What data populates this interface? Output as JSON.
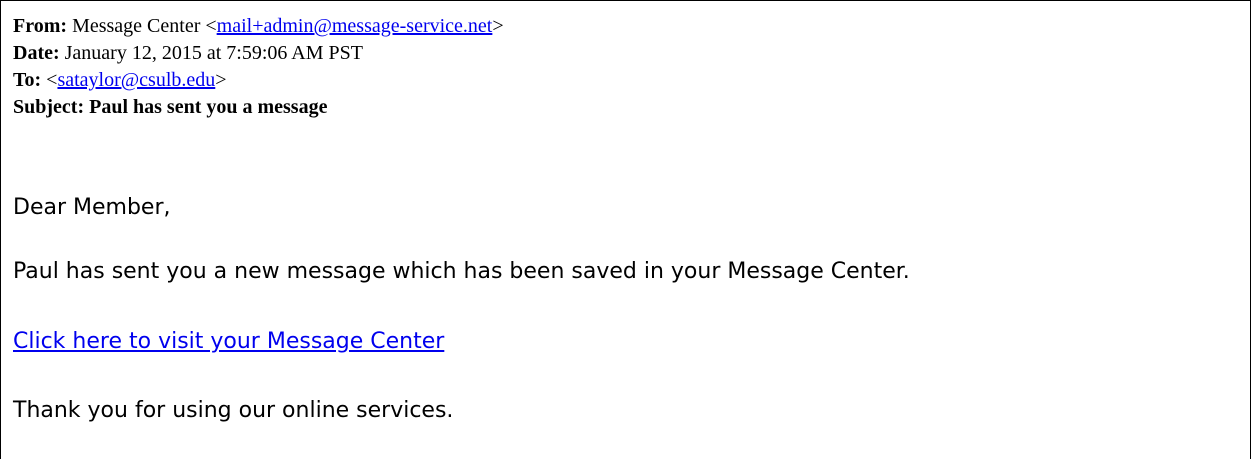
{
  "email": {
    "headers": {
      "from_key": "From:",
      "from_name": "Message Center",
      "from_open": "<",
      "from_email": "mail+admin@message-service.net",
      "from_close": ">",
      "date_key": "Date:",
      "date_value": "January 12, 2015 at 7:59:06 AM PST",
      "to_key": "To:",
      "to_open": "<",
      "to_email": "sataylor@csulb.edu",
      "to_close": ">",
      "subject_key": "Subject:",
      "subject_value": "Paul has sent you a message"
    },
    "body": {
      "greeting": "Dear Member,",
      "paragraph1": "Paul has sent you a new message which has been saved in your Message Center.",
      "link_text": "Click here to visit your Message Center",
      "paragraph2": "Thank you for using our online services."
    }
  },
  "colors": {
    "link": "#0000ee",
    "text": "#000000",
    "border": "#000000",
    "background": "#ffffff"
  }
}
